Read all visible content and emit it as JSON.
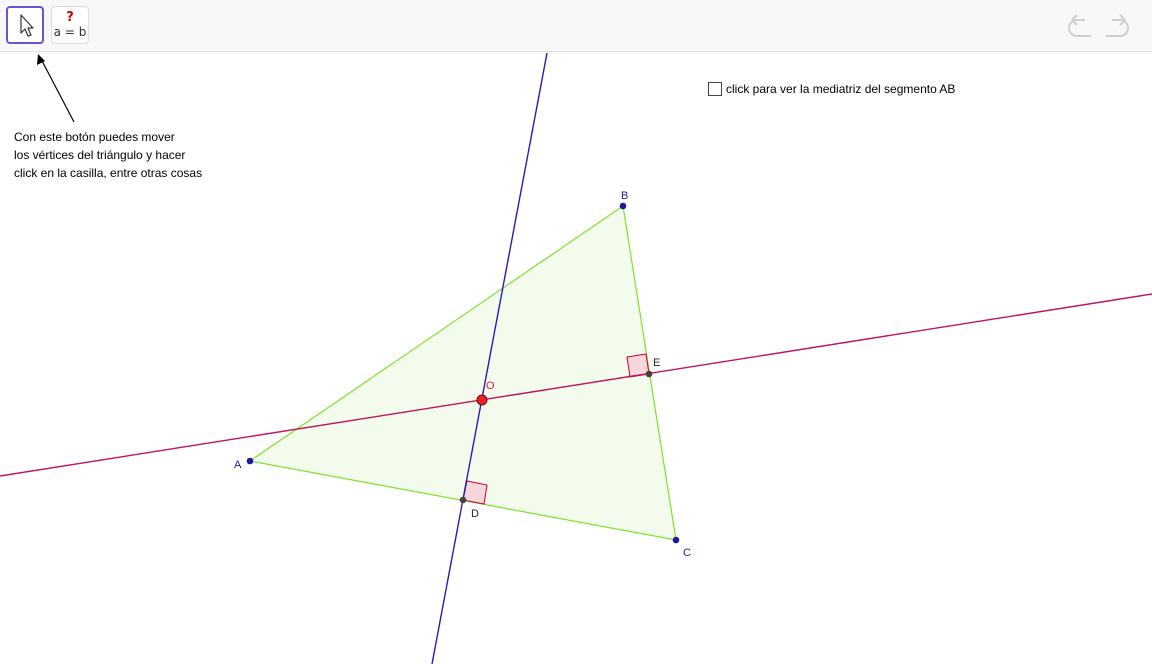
{
  "toolbar": {
    "move_tool": "move-tool",
    "relation_tool": {
      "top": "?",
      "bottom": "a = b"
    }
  },
  "help_text": [
    "Con este botón puedes mover",
    "los vértices del triángulo y hacer",
    "click en la casilla, entre otras cosas"
  ],
  "checkbox": {
    "label": "click para ver la mediatriz del segmento AB",
    "checked": false
  },
  "points": {
    "A": "A",
    "B": "B",
    "C": "C",
    "D": "D",
    "E": "E",
    "O": "O"
  },
  "colors": {
    "triangle_edge": "#7ee22e",
    "triangle_fill": "#f3fcec",
    "perp_line_1": "#2a1aba",
    "perp_line_2": "#c0145c",
    "vertex": "#1a1aa0",
    "point_O": "#e8202a",
    "right_angle_fill": "#f7d6dc",
    "right_angle_stroke": "#cc0033"
  }
}
